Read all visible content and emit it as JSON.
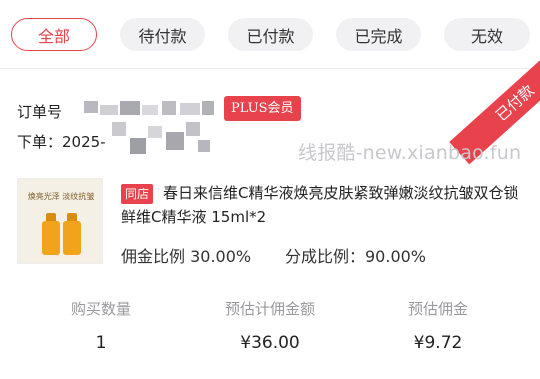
{
  "tabs": [
    "全部",
    "待付款",
    "已付款",
    "已完成",
    "无效"
  ],
  "order": {
    "order_no_label": "订单号",
    "order_time_label": "下单：2025-",
    "member_badge": "PLUS会员",
    "status_ribbon": "已付款"
  },
  "watermark": "线报酷-new.xianbao.fun",
  "product": {
    "shop_tag": "同店",
    "title": "春日来信维C精华液焕亮皮肤紧致弹嫩淡纹抗皱双仓锁鲜维C精华液 15ml*2",
    "image_caption_1": "焕亮光泽 淡纹抗皱",
    "commission_rate": "佣金比例 30.00%",
    "share_rate": "分成比例：90.00%"
  },
  "stats": [
    {
      "label": "购买数量",
      "value": "1"
    },
    {
      "label": "预估计佣金额",
      "value": "¥36.00"
    },
    {
      "label": "预估佣金",
      "value": "¥9.72"
    }
  ],
  "colors": {
    "accent": "#e8434c",
    "bottle": "#f0a31b"
  }
}
